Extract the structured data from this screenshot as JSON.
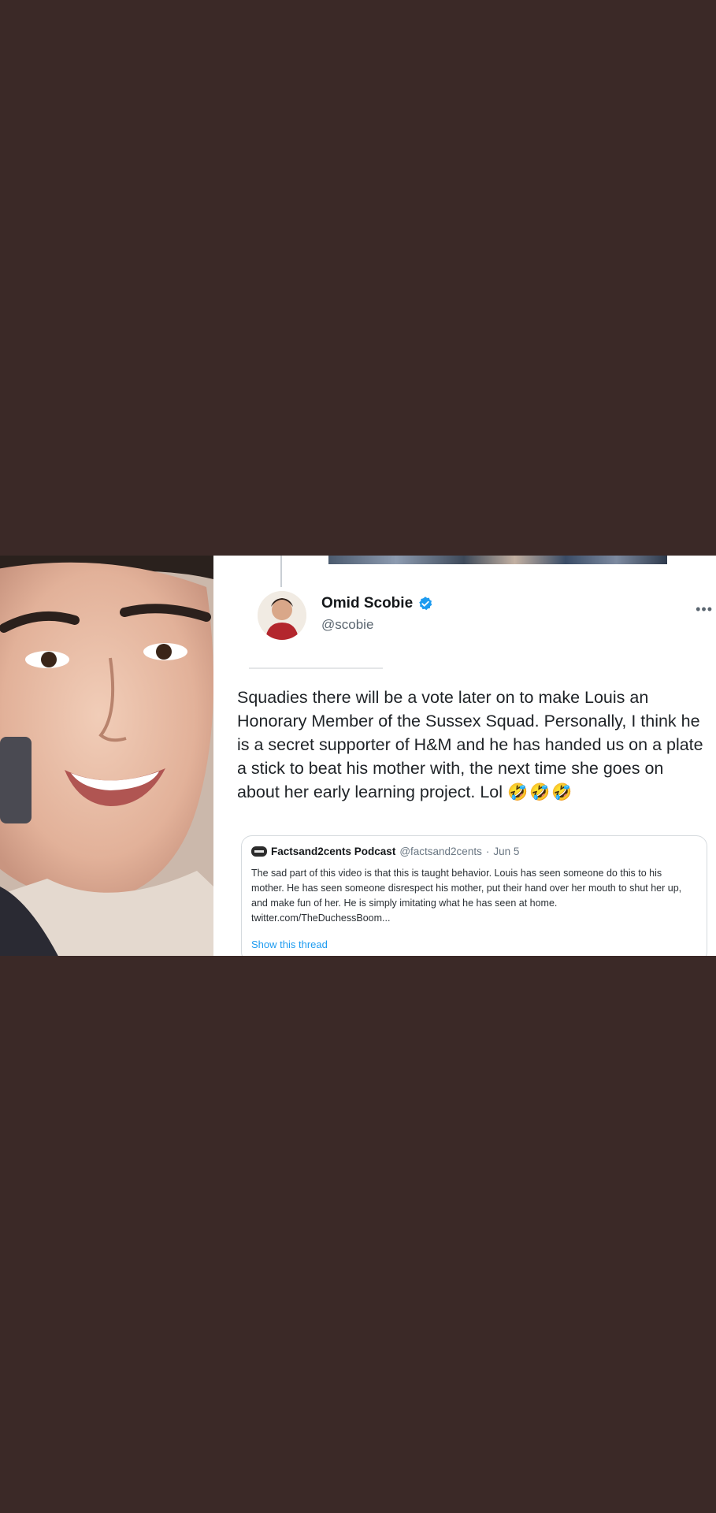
{
  "colors": {
    "background": "#3b2927",
    "card": "#ffffff",
    "verified_badge": "#1d9bf0",
    "link": "#1d9bf0"
  },
  "photo": {
    "icon": "portrait-photo"
  },
  "tweet": {
    "author": {
      "name": "Omid Scobie",
      "handle": "@scobie",
      "verified": true
    },
    "more_label": "•••",
    "text": "Squadies there will be a vote later on to make Louis an Honorary Member of the Sussex Squad. Personally, I think he is a secret supporter of H&M and he has handed us on a plate a stick to beat his mother with, the next time she goes on about her early learning project. Lol",
    "emojis": [
      "🤣",
      "🤣",
      "🤣"
    ],
    "quote": {
      "name": "Factsand2cents Podcast",
      "handle": "@factsand2cents",
      "date": "Jun 5",
      "separator": "·",
      "text": "The sad part of this video is that this is taught behavior. Louis has seen someone do this to his mother. He has seen someone disrespect his mother, put their hand over her mouth to shut her up, and make fun of her. He is simply imitating what he has seen at home. twitter.com/TheDuchessBoom...",
      "show_thread": "Show this thread"
    }
  }
}
